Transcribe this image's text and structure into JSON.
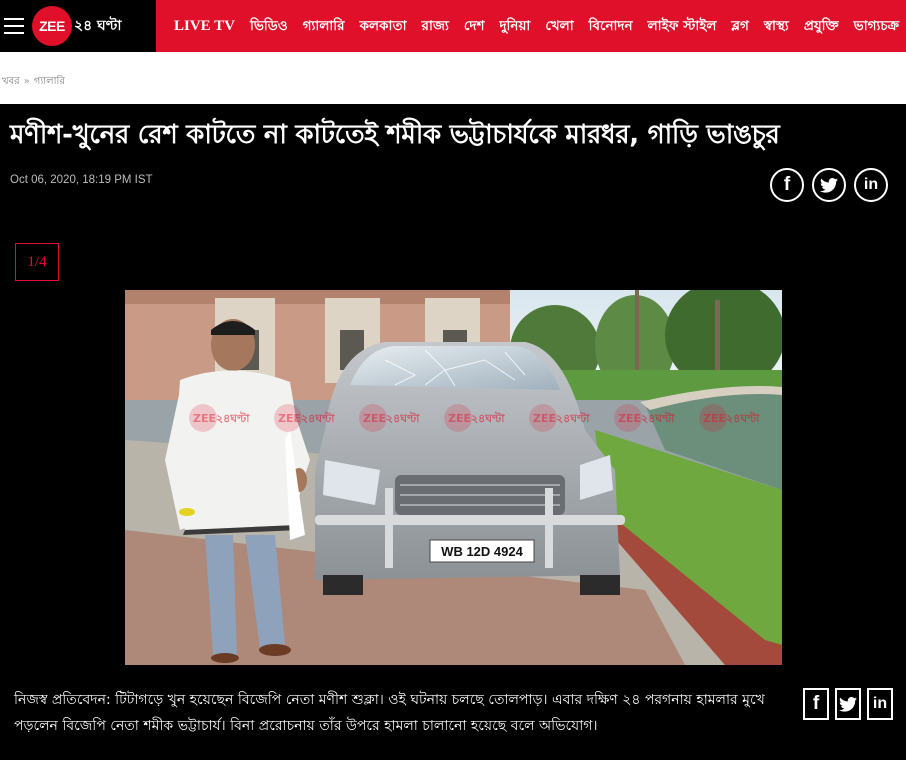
{
  "header": {
    "logo_text": "ZEE",
    "logo_tail": "২৪ ঘণ্টা",
    "nav": [
      "LIVE TV",
      "ভিডিও",
      "গ্যালারি",
      "কলকাতা",
      "রাজ্য",
      "দেশ",
      "দুনিয়া",
      "খেলা",
      "বিনোদন",
      "লাইফ স্টাইল",
      "ব্লগ",
      "স্বাস্থ্য",
      "প্রযুক্তি",
      "ভাগ্যচক্র"
    ]
  },
  "breadcrumb": {
    "items": [
      "খবর",
      "গ্যালারি"
    ],
    "separator": "»"
  },
  "article": {
    "headline": "মণীশ-খুনের রেশ কাটতে না কাটতেই শমীক ভট্টাচার্যকে মারধর, গাড়ি ভাঙচুর",
    "date": "Oct 06, 2020, 18:19 PM IST",
    "counter": "1/4",
    "caption": "নিজস্ব প্রতিবেদন: টিটাগড়ে খুন হয়েছেন বিজেপি নেতা মণীশ শুক্লা। ওই ঘটনায় চলছে তোলপাড়। এবার দক্ষিণ ২৪ পরগনায় হামলার মুখে পড়লেন বিজেপি নেতা শমীক ভট্টাচার্য। বিনা প্ররোচনায় তাঁর উপরে হামলা চালানো হয়েছে বলে অভিযোগ।"
  },
  "photo": {
    "number_plate": "WB 12D 4924",
    "watermark": "ZEE২৪ঘণ্টা"
  },
  "share": {
    "facebook": "f",
    "twitter": "twitter-bird",
    "linkedin": "in"
  },
  "colors": {
    "brand_red": "#e0102a",
    "article_bg": "#000000"
  }
}
